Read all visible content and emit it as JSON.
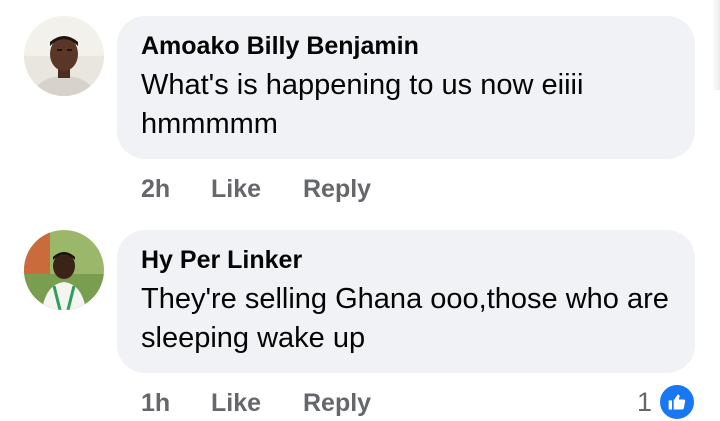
{
  "comments": [
    {
      "author": "Amoako Billy Benjamin",
      "text": "What's is happening to us now eiiii hmmmmm",
      "time": "2h",
      "like_label": "Like",
      "reply_label": "Reply"
    },
    {
      "author": "Hy Per Linker",
      "text": "They're  selling Ghana ooo,those who are sleeping wake up",
      "time": "1h",
      "like_label": "Like",
      "reply_label": "Reply",
      "reaction_count": "1",
      "reaction_icon": "like-reaction-icon"
    }
  ],
  "colors": {
    "bubble_bg": "#f0f2f5",
    "meta_text": "#65676b",
    "like_blue": "#1877f2"
  }
}
